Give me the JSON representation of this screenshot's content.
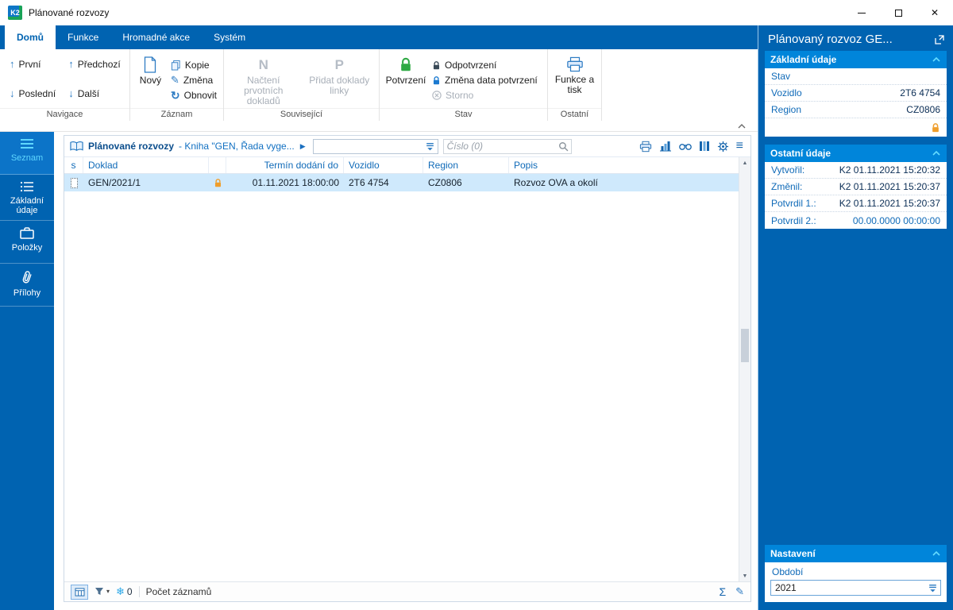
{
  "window": {
    "title": "Plánované rozvozy"
  },
  "icons": {
    "arrow_up": "↑",
    "arrow_down": "↓",
    "pencil": "✎",
    "refresh": "↻",
    "play": "▶",
    "menu": "≡",
    "sigma": "Σ",
    "snowflake": "❄",
    "letter_n": "N",
    "letter_p": "P",
    "close": "✕",
    "tri_up": "▲",
    "tri_down": "▼",
    "caret_down": "▾",
    "app_logo": "K2"
  },
  "ribbon": {
    "tabs": [
      {
        "label": "Domů"
      },
      {
        "label": "Funkce"
      },
      {
        "label": "Hromadné akce"
      },
      {
        "label": "Systém"
      }
    ],
    "navigace": {
      "label": "Navigace",
      "first": "První",
      "last": "Poslední",
      "prev": "Předchozí",
      "next": "Další"
    },
    "zaznam": {
      "label": "Záznam",
      "new": "Nový",
      "copy": "Kopie",
      "change": "Změna",
      "refresh": "Obnovit"
    },
    "souvisejici": {
      "label": "Související",
      "load_docs": "Načtení prvotních dokladů",
      "add_docs": "Přidat doklady linky"
    },
    "stav": {
      "label": "Stav",
      "confirm": "Potvrzení",
      "unconfirm": "Odpotvrzení",
      "change_date": "Změna data potvrzení",
      "cancel": "Storno"
    },
    "ostatni": {
      "label": "Ostatní",
      "functions_print": "Funkce a tisk"
    }
  },
  "sidebar": {
    "items": [
      {
        "label": "Seznam"
      },
      {
        "label": "Základní údaje"
      },
      {
        "label": "Položky"
      },
      {
        "label": "Přílohy"
      }
    ]
  },
  "main": {
    "header": {
      "title": "Plánované rozvozy",
      "book": "- Kniha \"GEN, Řada vyge...",
      "search_placeholder": "Číslo (0)"
    },
    "table": {
      "columns": {
        "s": "s",
        "doklad": "Doklad",
        "termin": "Termín dodání do",
        "vozidlo": "Vozidlo",
        "region": "Region",
        "popis": "Popis"
      },
      "rows": [
        {
          "doklad": "GEN/2021/1",
          "termin": "01.11.2021 18:00:00",
          "vozidlo": "2T6 4754",
          "region": "CZ0806",
          "popis": "Rozvoz OVA a okolí"
        }
      ]
    },
    "statusbar": {
      "filter_count": "0",
      "records_label": "Počet záznamů"
    }
  },
  "panel": {
    "title": "Plánovaný rozvoz GE...",
    "zakladni": {
      "title": "Základní údaje",
      "stav_label": "Stav",
      "vozidlo_label": "Vozidlo",
      "vozidlo_value": "2T6 4754",
      "region_label": "Region",
      "region_value": "CZ0806"
    },
    "ostatni": {
      "title": "Ostatní údaje",
      "rows": [
        {
          "label": "Vytvořil:",
          "value": "K2 01.11.2021 15:20:32"
        },
        {
          "label": "Změnil:",
          "value": "K2 01.11.2021 15:20:37"
        },
        {
          "label": "Potvrdil 1.:",
          "value": "K2 01.11.2021 15:20:37"
        },
        {
          "label": "Potvrdil 2.:",
          "value": "00.00.0000 00:00:00"
        }
      ]
    },
    "nastaveni": {
      "title": "Nastavení",
      "obdobi_label": "Období",
      "obdobi_value": "2021"
    }
  }
}
